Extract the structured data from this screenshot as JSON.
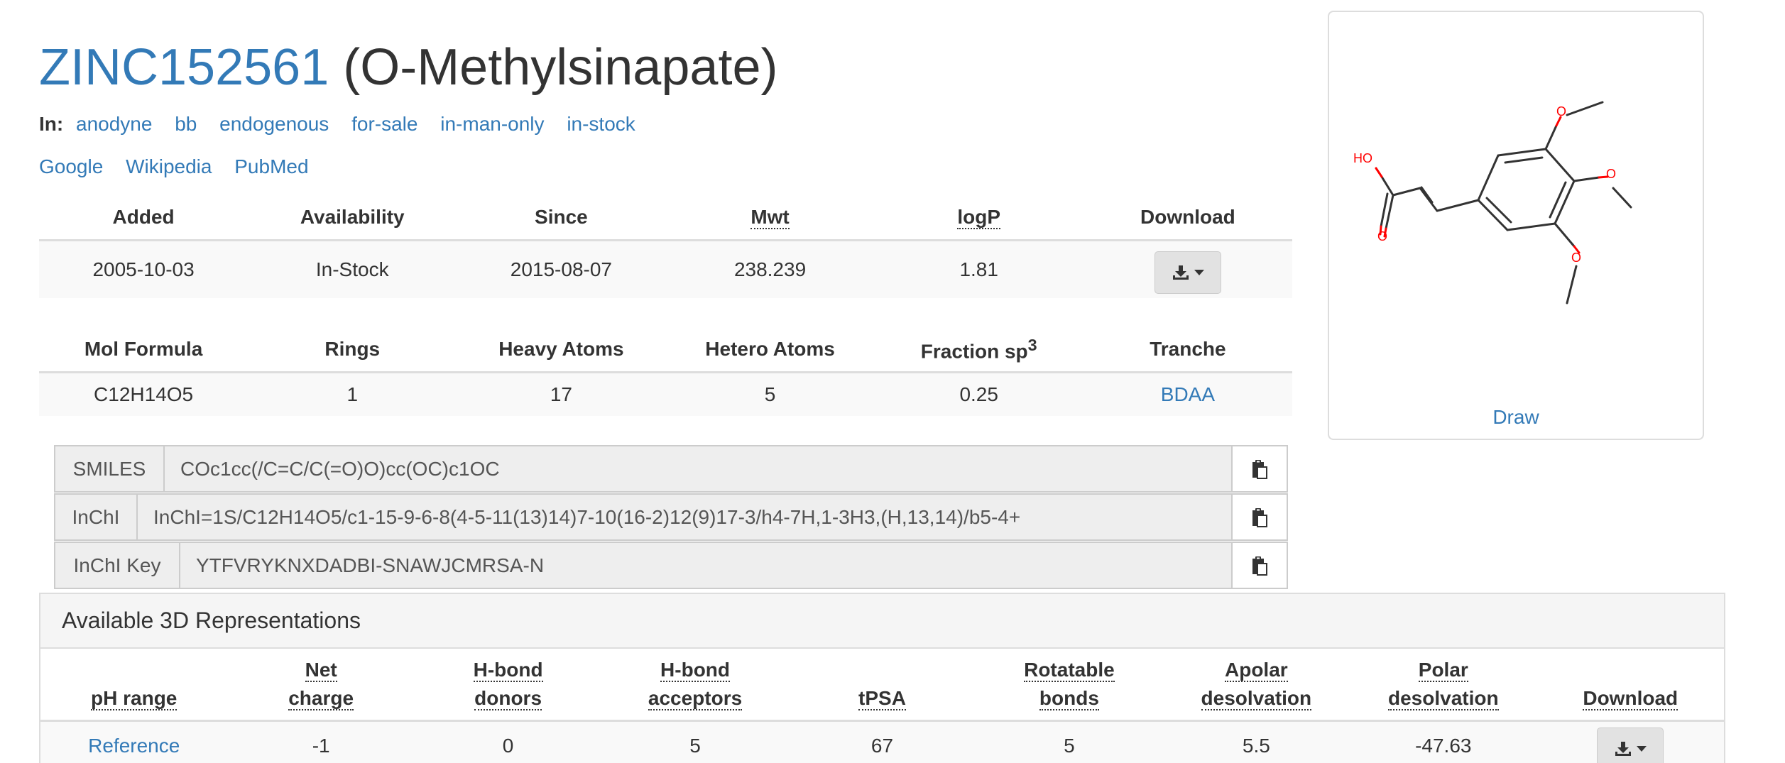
{
  "header": {
    "zinc_id": "ZINC152561",
    "name": "(O-Methylsinapate)"
  },
  "tags": {
    "label": "In:",
    "items": [
      "anodyne",
      "bb",
      "endogenous",
      "for-sale",
      "in-man-only",
      "in-stock"
    ]
  },
  "external_links": [
    "Google",
    "Wikipedia",
    "PubMed"
  ],
  "properties1": {
    "headers": [
      "Added",
      "Availability",
      "Since",
      "Mwt",
      "logP",
      "Download"
    ],
    "values": [
      "2005-10-03",
      "In-Stock",
      "2015-08-07",
      "238.239",
      "1.81"
    ]
  },
  "properties2": {
    "headers": [
      "Mol Formula",
      "Rings",
      "Heavy Atoms",
      "Hetero Atoms",
      "Fraction sp",
      "Tranche"
    ],
    "fraction_sup": "3",
    "values": [
      "C12H14O5",
      "1",
      "17",
      "5",
      "0.25",
      "BDAA"
    ]
  },
  "identifiers": {
    "smiles": {
      "label": "SMILES",
      "value": "COc1cc(/C=C/C(=O)O)cc(OC)c1OC"
    },
    "inchi": {
      "label": "InChI",
      "value": "InChI=1S/C12H14O5/c1-15-9-6-8(4-5-11(13)14)7-10(16-2)12(9)17-3/h4-7H,1-3H3,(H,13,14)/b5-4+"
    },
    "inchikey": {
      "label": "InChI Key",
      "value": "YTFVRYKNXDADBI-SNAWJCMRSA-N"
    }
  },
  "rep3d": {
    "title": "Available 3D Representations",
    "headers": {
      "ph_range": "pH range",
      "net_charge": [
        "Net",
        "charge"
      ],
      "hbd": [
        "H-bond",
        "donors"
      ],
      "hba": [
        "H-bond",
        "acceptors"
      ],
      "tpsa": "tPSA",
      "rotatable": [
        "Rotatable",
        "bonds"
      ],
      "apolar": [
        "Apolar",
        "desolvation"
      ],
      "polar": [
        "Polar",
        "desolvation"
      ],
      "download": "Download"
    },
    "row": {
      "ph_range": "Reference",
      "net_charge": "-1",
      "hbd": "0",
      "hba": "5",
      "tpsa": "67",
      "rotatable": "5",
      "apolar": "5.5",
      "polar": "-47.63"
    }
  },
  "structure": {
    "draw_label": "Draw",
    "atom_labels": {
      "ho": "HO",
      "o": "O"
    },
    "colors": {
      "bond": "#333333",
      "hetero": "#ff0000"
    }
  },
  "icons": {
    "download": "download-icon",
    "caret": "caret-down-icon",
    "clipboard": "clipboard-icon"
  }
}
